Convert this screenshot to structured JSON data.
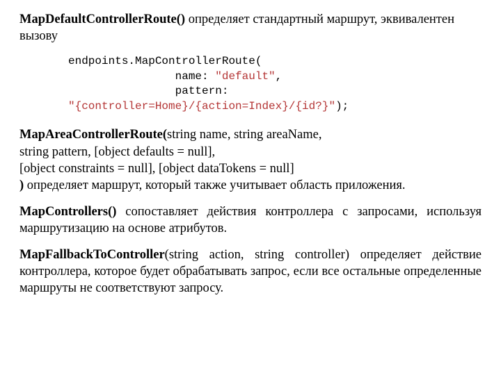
{
  "p1": {
    "method": "MapDefaultControllerRoute()",
    "text": " определяет стандартный маршрут, эквивалентен вызову"
  },
  "code": {
    "l1": "endpoints.MapControllerRoute(",
    "l2_pad": "                name: ",
    "l2_str": "\"default\"",
    "l2_comma": ",",
    "l3": "                pattern:",
    "l4_str": "\"{controller=Home}/{action=Index}/{id?}\"",
    "l4_end": ");"
  },
  "p2": {
    "method": "MapAreaControllerRoute(",
    "sig1": "string name, string areaName,",
    "sig2": "string pattern, [object defaults = null],",
    "sig3": "[object constraints = null], [object dataTokens = null]",
    "close": ")",
    "rest1": " определяет маршрут, который также учитывает область приложения."
  },
  "p3": {
    "method": "MapControllers()",
    "text": " сопоставляет действия контроллера с запросами, используя маршрутизацию на основе атрибутов."
  },
  "p4": {
    "method": "MapFallbackToController",
    "sig": "(string action, string controller)",
    "text": " определяет действие контроллера, которое будет обрабатывать запрос, если все остальные определенные маршруты не соответствуют запросу."
  }
}
